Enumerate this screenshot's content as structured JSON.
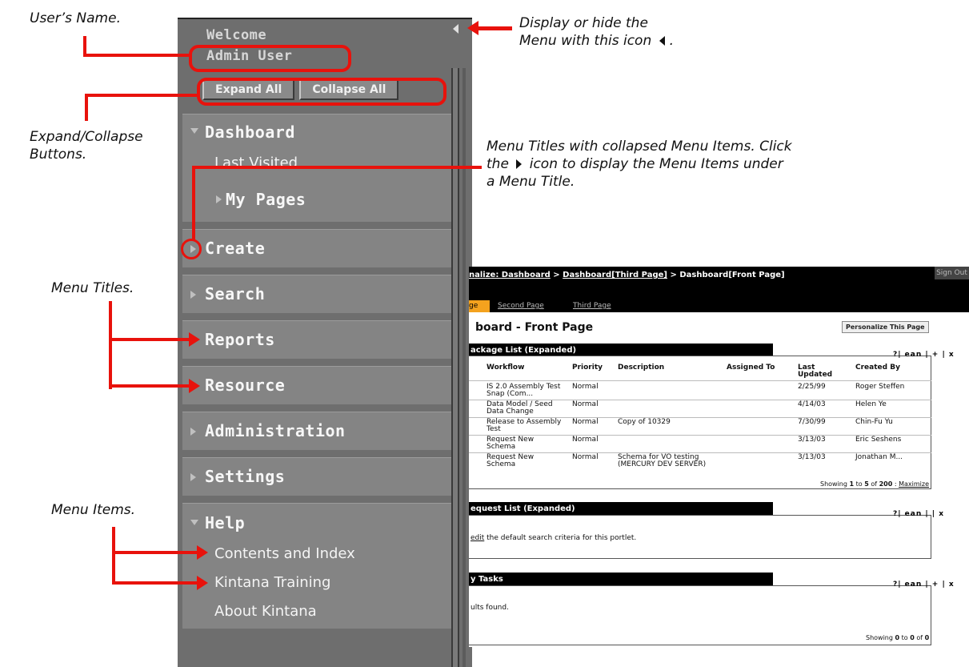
{
  "annotations": {
    "users_name": "User’s Name.",
    "display_hide_line1": "Display or hide the",
    "display_hide_line2": "Menu with this icon",
    "display_hide_suffix": ".",
    "expand_collapse_line1": "Expand/Collapse",
    "expand_collapse_line2": "Buttons.",
    "collapsed_line1": "Menu Titles with collapsed Menu Items. Click",
    "collapsed_line2_pre": "the",
    "collapsed_line2_post": "icon to display the Menu Items under",
    "collapsed_line3": "a Menu Title.",
    "menu_titles": "Menu Titles.",
    "menu_items": "Menu Items."
  },
  "menu": {
    "welcome": "Welcome",
    "user": "Admin User",
    "expand_all": "Expand All",
    "collapse_all": "Collapse All",
    "sections": [
      {
        "title": "Dashboard",
        "state": "expanded"
      },
      {
        "title": "Create",
        "state": "collapsed"
      },
      {
        "title": "Search",
        "state": "collapsed"
      },
      {
        "title": "Reports",
        "state": "collapsed"
      },
      {
        "title": "Resource",
        "state": "collapsed"
      },
      {
        "title": "Administration",
        "state": "collapsed"
      },
      {
        "title": "Settings",
        "state": "collapsed"
      },
      {
        "title": "Help",
        "state": "expanded"
      }
    ],
    "dashboard_items": [
      "Last Visited",
      "My Pages"
    ],
    "help_items": [
      "Contents and Index",
      "Kintana Training",
      "About Kintana"
    ]
  },
  "app": {
    "breadcrumb_personalize": "nalize: Dashboard",
    "breadcrumb_sep1": ">",
    "breadcrumb_third": "Dashboard[Third Page]",
    "breadcrumb_sep2": "> Dashboard[Front Page]",
    "sign_out": "Sign Out",
    "tab_active": "ge",
    "tab_second": "Second Page",
    "tab_third": "Third Page",
    "page_title": "board - Front Page",
    "personalize_button": "Personalize This Page",
    "portlet1": {
      "title": "ackage List (Expanded)",
      "controls": "?| ean | + | x",
      "headers": [
        "Workflow",
        "Priority",
        "Description",
        "Assigned To",
        "Last Updated",
        "Created By"
      ],
      "rows": [
        [
          "IS 2.0 Assembly Test Snap (Com...",
          "Normal",
          "",
          "",
          "2/25/99",
          "Roger Steffen"
        ],
        [
          "Data Model / Seed Data Change",
          "Normal",
          "",
          "",
          "4/14/03",
          "Helen Ye"
        ],
        [
          "Release to Assembly Test",
          "Normal",
          "Copy of 10329",
          "",
          "7/30/99",
          "Chin-Fu Yu"
        ],
        [
          "Request New Schema",
          "Normal",
          "",
          "",
          "3/13/03",
          "Eric Seshens"
        ],
        [
          "Request New Schema",
          "Normal",
          "Schema for VO testing (MERCURY DEV SERVER)",
          "",
          "3/13/03",
          "Jonathan M..."
        ]
      ],
      "footer_pre": "Showing",
      "footer_from": "1",
      "footer_mid": "to",
      "footer_to": "5",
      "footer_of": "of",
      "footer_total": "200",
      "footer_sep": ":",
      "footer_link": "Maximize"
    },
    "portlet2": {
      "title": "equest List (Expanded)",
      "controls": "?| ean |  | x",
      "text_link": "edit",
      "text_rest": "the default search criteria for this portlet."
    },
    "portlet3": {
      "title": "y Tasks",
      "controls": "?| ean | + | x",
      "text": "ults found.",
      "footer_pre": "Showing",
      "footer_from": "0",
      "footer_mid": "to",
      "footer_to": "0",
      "footer_of": "of",
      "footer_total": "0"
    }
  },
  "colors": {
    "annotation_red": "#e8120c",
    "menu_bg": "#6e6e6e",
    "section_bg": "#848484",
    "tab_active": "#f4a21e"
  }
}
